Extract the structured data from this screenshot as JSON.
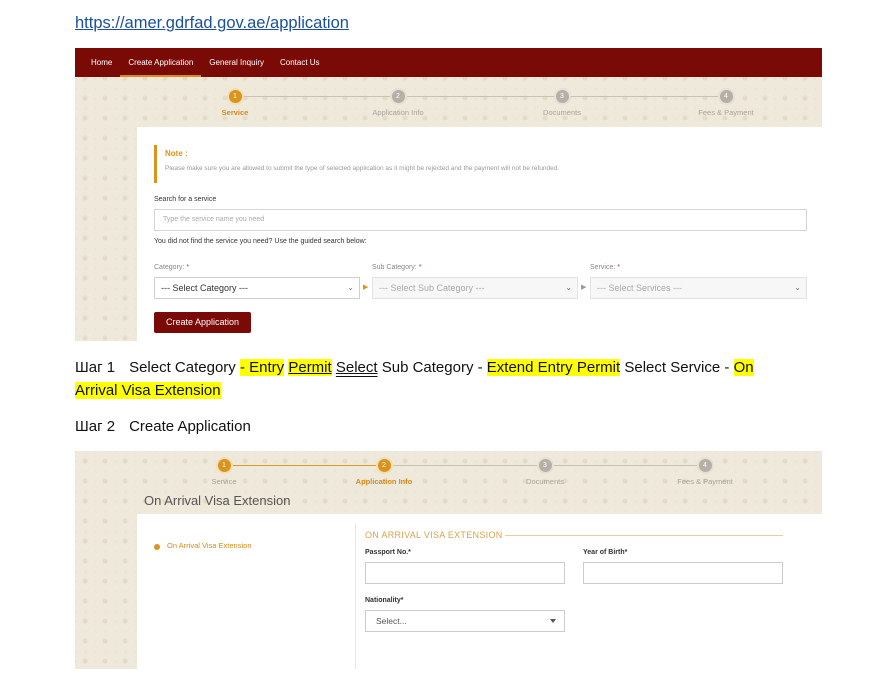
{
  "doc": {
    "link": "https://amer.gdrfad.gov.ae/application"
  },
  "shot1": {
    "nav": [
      "Home",
      "Create Application",
      "General Inquiry",
      "Contact Us"
    ],
    "active_nav": "Create Application",
    "steps": [
      {
        "num": "1",
        "label": "Service",
        "active": true
      },
      {
        "num": "2",
        "label": "Application Info",
        "active": false
      },
      {
        "num": "3",
        "label": "Documents",
        "active": false
      },
      {
        "num": "4",
        "label": "Fees & Payment",
        "active": false
      }
    ],
    "note_title": "Note :",
    "note_text": "Please make sure you are allowed to submit the type of selected application as it might be rejected and the payment will not be refunded.",
    "search_label": "Search for a service",
    "search_placeholder": "Type the service name you need",
    "guided_text": "You did not find the service you need? Use the guided search below:",
    "category_label": "Category:",
    "subcategory_label": "Sub Category:",
    "service_label": "Service:",
    "required_mark": "*",
    "category_value": "--- Select Category ---",
    "subcategory_value": "--- Select Sub Category ---",
    "service_value": "--- Select Services ---",
    "create_button": "Create Application"
  },
  "instructions": {
    "step1_prefix": "Шаг 1",
    "step1_a": "Select Category",
    "step1_b": "- Entry",
    "step1_c": "Permit",
    "step1_d": "Select",
    "step1_e": "Sub Category -",
    "step1_f": "Extend Entry Permit",
    "step1_g": "Select Service -",
    "step1_h": "On",
    "step1_i": "Arrival Visa Extension",
    "step2_prefix": "Шаг 2",
    "step2_text": "Create Application"
  },
  "shot2": {
    "steps": [
      {
        "num": "1",
        "label": "Service",
        "active": true
      },
      {
        "num": "2",
        "label": "Application Info",
        "active": true
      },
      {
        "num": "3",
        "label": "Documents",
        "active": false
      },
      {
        "num": "4",
        "label": "Fees & Payment",
        "active": false
      }
    ],
    "page_title": "On Arrival Visa Extension",
    "side_item": "On Arrival Visa Extension",
    "section_title": "ON ARRIVAL VISA EXTENSION",
    "passport_label": "Passport No.*",
    "birth_label": "Year of Birth*",
    "nationality_label": "Nationality*",
    "nationality_value": "Select..."
  },
  "colors": {
    "nav_bg": "#7a0a06",
    "accent": "#d9941e",
    "highlight": "#ffff00",
    "link": "#1a4f9c"
  }
}
